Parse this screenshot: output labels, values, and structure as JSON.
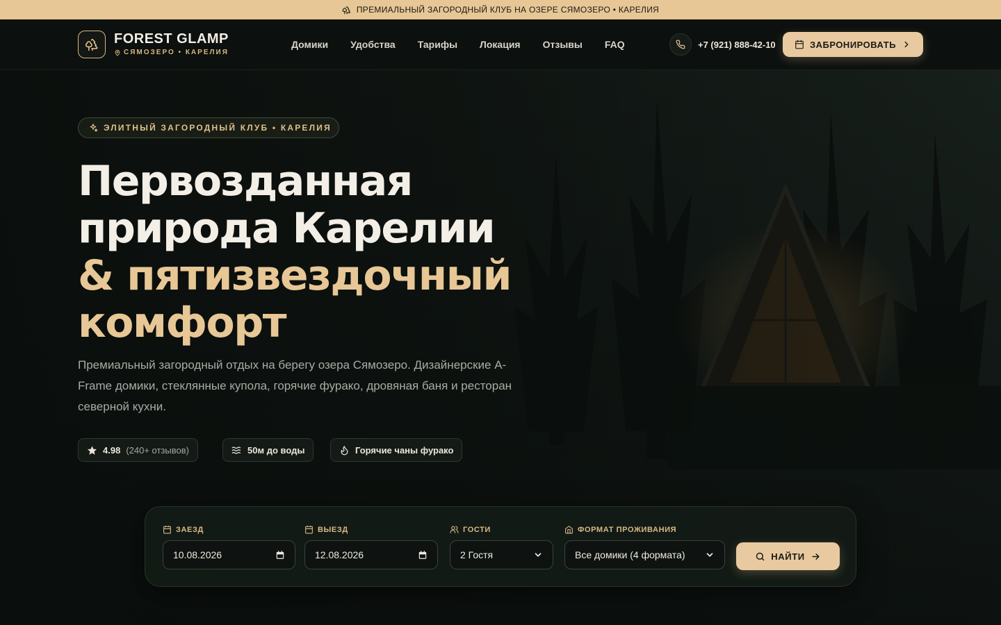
{
  "announcement": {
    "icon": "trees-icon",
    "text": "ПРЕМИАЛЬНЫЙ ЗАГОРОДНЫЙ КЛУБ НА ОЗЕРЕ СЯМОЗЕРО • КАРЕЛИЯ"
  },
  "header": {
    "logo_icon": "trees-icon",
    "brand_name": "FOREST GLAMP",
    "brand_location": "СЯМОЗЕРО • КАРЕЛИЯ",
    "nav": [
      "Домики",
      "Удобства",
      "Тарифы",
      "Локация",
      "Отзывы",
      "FAQ"
    ],
    "phone": "+7 (921) 888-42-10",
    "book_label": "ЗАБРОНИРОВАТЬ"
  },
  "hero": {
    "badge": "ЭЛИТНЫЙ ЗАГОРОДНЫЙ КЛУБ • КАРЕЛИЯ",
    "title_line1": "Первозданная",
    "title_line2": "природа Карелии",
    "title_line3": "& пятизвездочный",
    "title_line4": "комфорт",
    "description": "Премиальный загородный отдых на берегу озера Сямозеро. Дизайнерские A-Frame домики, стеклянные купола, горячие фурако, дровяная баня и ресторан северной кухни.",
    "rating": {
      "value": "4.98",
      "reviews": "(240+ отзывов)"
    },
    "chip_water": "50м до воды",
    "chip_hot_tub": "Горячие чаны фурако"
  },
  "booking": {
    "checkin_label": "ЗАЕЗД",
    "checkin_value": "10.08.2026",
    "checkout_label": "ВЫЕЗД",
    "checkout_value": "12.08.2026",
    "guests_label": "ГОСТИ",
    "guests_value": "2 Гостя",
    "format_label": "ФОРМАТ ПРОЖИВАНИЯ",
    "format_value": "Все домики (4 формата)",
    "search_label": "НАЙТИ"
  },
  "colors": {
    "accent": "#e7c795",
    "background": "#0b0f0d",
    "topbar": "#e7c795",
    "button": "#e9caa0"
  }
}
